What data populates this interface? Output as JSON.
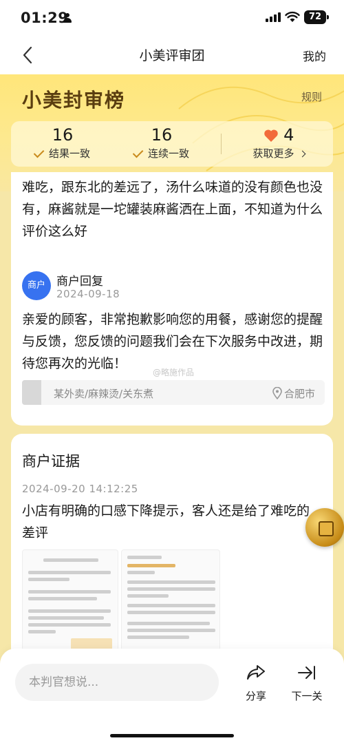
{
  "status_bar": {
    "time": "01:29",
    "battery": "72"
  },
  "nav": {
    "title": "小美评审团",
    "right_label": "我的"
  },
  "banner": {
    "logo": "小美封审榜",
    "rules_label": "规则"
  },
  "stats": [
    {
      "value": "16",
      "label": "结果一致"
    },
    {
      "value": "16",
      "label": "连续一致"
    },
    {
      "value": "4",
      "label": "获取更多"
    }
  ],
  "review": {
    "text": "难吃，跟东北的差远了，汤什么味道的没有颜色也没有，麻酱就是一坨罐装麻酱洒在上面，不知道为什么评价这么好",
    "avatar_label": "商户",
    "reply_title": "商户回复",
    "reply_date": "2024-09-18",
    "reply_text": "亲爱的顾客，非常抱歉影响您的用餐，感谢您的提醒与反馈，您反馈的问题我们会在下次服务中改进，期待您再次的光临！",
    "watermark": "@略施作品",
    "shop_name": "某外卖/麻辣烫/关东煮",
    "shop_city": "合肥市"
  },
  "evidence": {
    "title": "商户证据",
    "date": "2024-09-20 14:12:25",
    "text": "小店有明确的口感下降提示，客人还是给了难吃的差评"
  },
  "bottom": {
    "input_placeholder": "本判官想说...",
    "share_label": "分享",
    "next_label": "下一关"
  },
  "colors": {
    "accent": "#c98a1b",
    "heart": "#f26b3a",
    "banner": "#ffe67a",
    "avatar": "#3772f0"
  }
}
